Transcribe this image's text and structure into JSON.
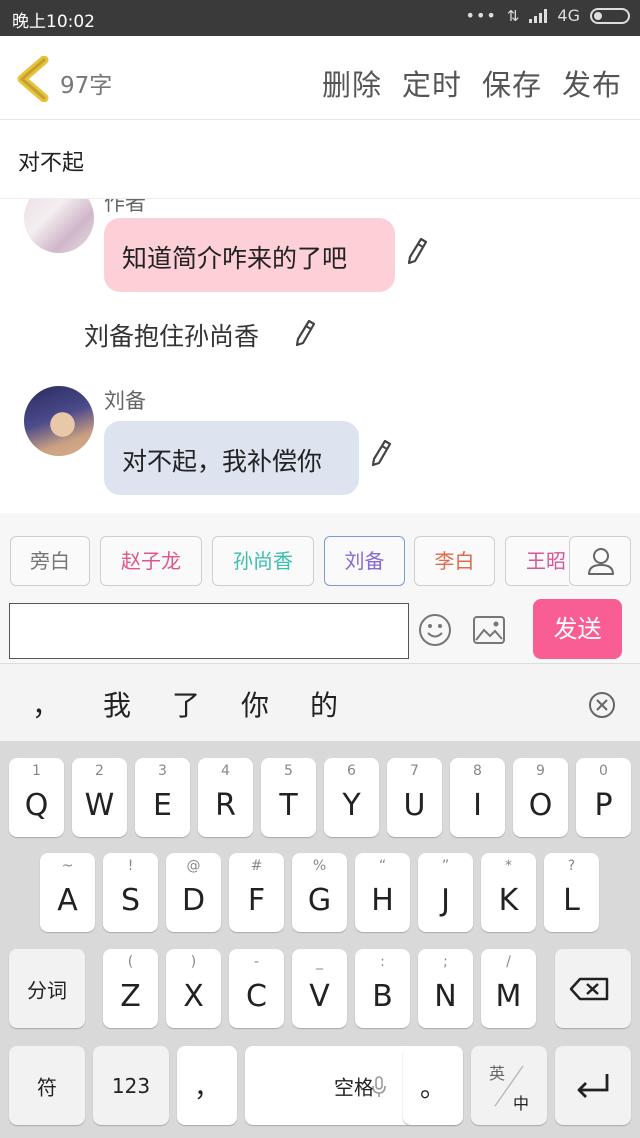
{
  "status_bar": {
    "time": "晚上10:02",
    "network": "4G"
  },
  "header": {
    "word_count": "97字",
    "actions": [
      "删除",
      "定时",
      "保存",
      "发布"
    ]
  },
  "title": "对不起",
  "chat": {
    "top_speaker_fragment": "作者",
    "message1": "知道简介咋来的了吧",
    "narration": "刘备抱住孙尚香",
    "speaker2": "刘备",
    "message2": "对不起，我补偿你"
  },
  "characters": [
    {
      "name": "旁白",
      "color": "#777777"
    },
    {
      "name": "赵子龙",
      "color": "#e0548c"
    },
    {
      "name": "孙尚香",
      "color": "#3bbfae"
    },
    {
      "name": "刘备",
      "color": "#8a6ad1"
    },
    {
      "name": "李白",
      "color": "#e06a4f"
    },
    {
      "name": "王昭",
      "color": "#d8579a"
    }
  ],
  "composer": {
    "input_value": "",
    "send_label": "发送"
  },
  "candidates": [
    "，",
    "我",
    "了",
    "你",
    "的"
  ],
  "keyboard": {
    "row1": [
      {
        "k": "Q",
        "s": "1"
      },
      {
        "k": "W",
        "s": "2"
      },
      {
        "k": "E",
        "s": "3"
      },
      {
        "k": "R",
        "s": "4"
      },
      {
        "k": "T",
        "s": "5"
      },
      {
        "k": "Y",
        "s": "6"
      },
      {
        "k": "U",
        "s": "7"
      },
      {
        "k": "I",
        "s": "8"
      },
      {
        "k": "O",
        "s": "9"
      },
      {
        "k": "P",
        "s": "0"
      }
    ],
    "row2": [
      {
        "k": "A",
        "s": "~"
      },
      {
        "k": "S",
        "s": "!"
      },
      {
        "k": "D",
        "s": "@"
      },
      {
        "k": "F",
        "s": "#"
      },
      {
        "k": "G",
        "s": "%"
      },
      {
        "k": "H",
        "s": "“"
      },
      {
        "k": "J",
        "s": "”"
      },
      {
        "k": "K",
        "s": "*"
      },
      {
        "k": "L",
        "s": "?"
      }
    ],
    "row3": [
      {
        "k": "Z",
        "s": "("
      },
      {
        "k": "X",
        "s": ")"
      },
      {
        "k": "C",
        "s": "-"
      },
      {
        "k": "V",
        "s": "_"
      },
      {
        "k": "B",
        "s": ":"
      },
      {
        "k": "N",
        "s": ";"
      },
      {
        "k": "M",
        "s": "/"
      }
    ],
    "fenci": "分词",
    "fu": "符",
    "num": "123",
    "comma": "，",
    "space": "空格",
    "period": "。",
    "lang_top": "英",
    "lang_bottom": "中"
  }
}
